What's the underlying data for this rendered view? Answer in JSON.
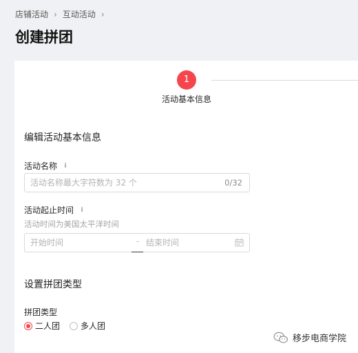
{
  "breadcrumb": {
    "items": [
      "店铺活动",
      "互动活动"
    ],
    "separator": "›"
  },
  "page": {
    "title": "创建拼团"
  },
  "steps": [
    {
      "number": "1",
      "label": "活动基本信息",
      "active": true
    }
  ],
  "section_basic": {
    "title": "编辑活动基本信息"
  },
  "name_field": {
    "label": "活动名称",
    "placeholder": "活动名称最大字符数为 32 个",
    "value": "",
    "counter": "0/32"
  },
  "time_field": {
    "label": "活动起止时间",
    "hint": "活动时间为美国太平洋时间",
    "start_placeholder": "开始时间",
    "end_placeholder": "结束时间",
    "separator": "-"
  },
  "section_type": {
    "title": "设置拼团类型"
  },
  "type_field": {
    "label": "拼团类型",
    "options": [
      {
        "label": "二人团",
        "checked": true
      },
      {
        "label": "多人团",
        "checked": false
      }
    ]
  },
  "watermark": {
    "text": "移步电商学院"
  },
  "colors": {
    "accent": "#f5464b",
    "background": "#f0f1f4"
  },
  "icons": {
    "info": "info-icon",
    "calendar": "calendar-icon",
    "watermark": "wechat-icon"
  }
}
